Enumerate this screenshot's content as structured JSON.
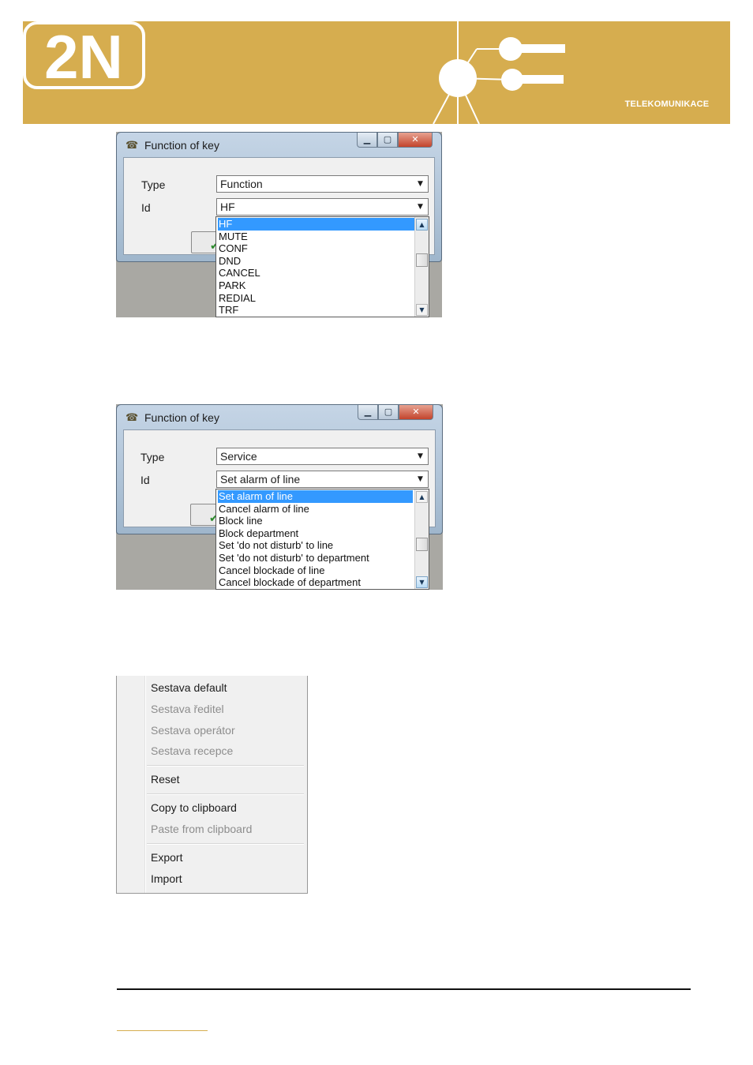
{
  "banner": {
    "logo_text": "2N",
    "logo_subtitle": "TELEKOMUNIKACE",
    "colors": {
      "background": "#d6ad4f",
      "foreground": "#ffffff"
    }
  },
  "dialog1": {
    "title": "Function of key",
    "window_icon": "phone-icon",
    "caption_buttons": {
      "minimize": "minimize-icon",
      "maximize": "maximize-icon",
      "close": "close-icon"
    },
    "type_label": "Type",
    "type_value": "Function",
    "id_label": "Id",
    "id_value": "HF",
    "list": [
      "HF",
      "MUTE",
      "CONF",
      "DND",
      "CANCEL",
      "PARK",
      "REDIAL",
      "TRF"
    ],
    "selected_index": 0
  },
  "dialog2": {
    "title": "Function of key",
    "window_icon": "phone-icon",
    "caption_buttons": {
      "minimize": "minimize-icon",
      "maximize": "maximize-icon",
      "close": "close-icon"
    },
    "type_label": "Type",
    "type_value": "Service",
    "id_label": "Id",
    "id_value": "Set alarm of line",
    "list": [
      "Set alarm of line",
      "Cancel alarm of line",
      "Block line",
      "Block department",
      "Set 'do not disturb' to line",
      "Set 'do not disturb' to department",
      "Cancel blockade of line",
      "Cancel blockade of department"
    ],
    "selected_index": 0
  },
  "context_menu": {
    "items": [
      {
        "label": "Sestava default",
        "enabled": true
      },
      {
        "label": "Sestava ředitel",
        "enabled": false
      },
      {
        "label": "Sestava operátor",
        "enabled": false
      },
      {
        "label": "Sestava recepce",
        "enabled": false
      },
      {
        "label": "Reset",
        "enabled": true
      },
      {
        "label": "Copy to clipboard",
        "enabled": true
      },
      {
        "label": "Paste from clipboard",
        "enabled": false
      },
      {
        "label": "Export",
        "enabled": true
      },
      {
        "label": "Import",
        "enabled": true
      }
    ]
  }
}
